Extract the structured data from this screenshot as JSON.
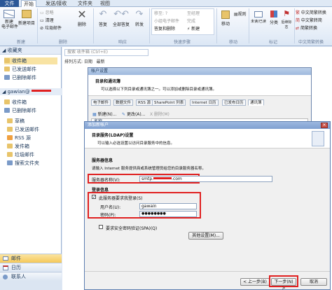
{
  "ribbon": {
    "tabs": [
      "文件",
      "开始",
      "发送/接收",
      "文件夹",
      "视图"
    ],
    "new_email": "新建\n电子邮件",
    "new_items": "新建项目",
    "ignore": "忽略",
    "cleanup": "清理",
    "junk": "垃圾邮件",
    "delete": "删除",
    "reply": "答复",
    "reply_all": "全部答复",
    "forward": "转发",
    "move_to": "移至: ?",
    "to_manager": "至经理",
    "team_email": "小组电子邮件",
    "done": "完成",
    "reply_delete": "答复和删除",
    "create_new": "新建",
    "move": "移动",
    "rules": "规则",
    "unread_read": "未读/已读",
    "categorize": "分类",
    "follow_up": "后续标志",
    "find_contact": "查找联系人",
    "address_book": "通讯簿",
    "filter_email": "筛选电子邮件",
    "simp_trad": "中文简繁转换",
    "trad_simp": "中文繁转简",
    "simp_trad2": "简繁转换",
    "groups": [
      "新建",
      "删除",
      "响应",
      "快速步骤",
      "移动",
      "标记",
      "查找",
      "中文简繁转换"
    ]
  },
  "nav": {
    "favorites": "收藏夹",
    "fav_items": [
      "收件箱",
      "已发送邮件",
      "已删除邮件"
    ],
    "account": "gawian@",
    "acct_items": [
      "收件箱",
      "已删除邮件",
      "草稿",
      "已发送邮件",
      "RSS 源",
      "发件箱",
      "垃圾邮件",
      "搜索文件夹"
    ],
    "bottom": [
      "邮件",
      "日历",
      "联系人"
    ]
  },
  "main": {
    "search_placeholder": "搜索 收件箱 (Ctrl+E)",
    "sort": "排列方式: 日期",
    "sort_col": "最新"
  },
  "dialog1": {
    "title": "帐户设置",
    "heading": "目录和通讯簿",
    "sub": "可以选择以下列目录或通讯簿之一。可以添加或删除目录或通讯簿。",
    "tabs": [
      "电子邮件",
      "数据文件",
      "RSS 源",
      "SharePoint 列表",
      "Internet 日历",
      "已发布日历",
      "通讯簿"
    ],
    "new": "新建(N)...",
    "change": "更改(A)...",
    "delete": "X 删除(M)",
    "col_name": "名称"
  },
  "dialog2": {
    "title": "添加新帐户",
    "heading": "目录服务(LDAP)设置",
    "sub": "可以输入必选设置以访问目录服务中的信息。",
    "server_info": "服务器信息",
    "server_desc": "请输入 Internet 服务提供商或系统管理员给您的目录服务器名称。",
    "server_label": "服务器名称(V):",
    "server_value": "smtp.",
    "server_value2": ".com",
    "login_info": "登录信息",
    "require_login": "此服务器要求我登录(S)",
    "user_label": "用户名(U):",
    "user_value": "gawain",
    "pass_label": "密码(P):",
    "pass_value": "●●●●●●●●",
    "spa": "要求安全密码验证(SPA)(Q)",
    "more": "其他设置(M)...",
    "back": "< 上一步(B)",
    "next": "下一步(N) >",
    "cancel": "取消"
  },
  "colors": {
    "accent": "#2b5797",
    "red": "#e02020"
  }
}
